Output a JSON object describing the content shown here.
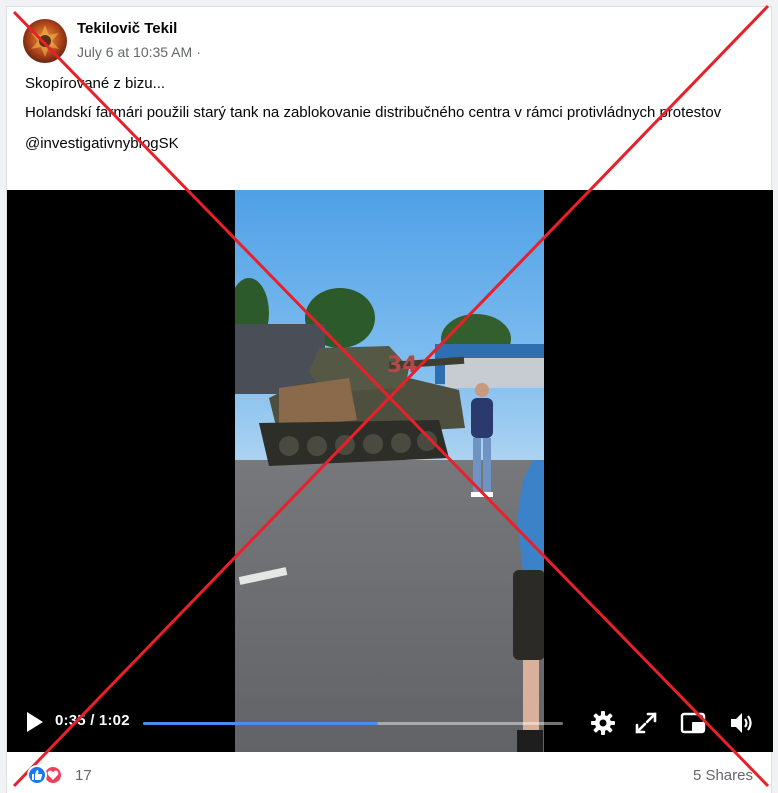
{
  "post": {
    "author": "Tekilovič Tekil",
    "timestamp": "July 6 at 10:35 AM",
    "separator": "·",
    "text_line_1": "Skopírované z bizu...",
    "text_line_2": "Holandskí farmári použili starý tank na zablokovanie distribučného centra v rámci protivládnych protestov",
    "text_line_3": "@investigativnyblogSK"
  },
  "video": {
    "timecode": "0:35 / 1:02",
    "progress": 0.56,
    "tank_marking": "34",
    "icons": [
      "play-icon",
      "settings-gear-icon",
      "fullscreen-icon",
      "picture-in-picture-icon",
      "volume-icon"
    ]
  },
  "footer": {
    "reaction_count": "17",
    "shares": "5 Shares",
    "reaction_icons": [
      "like-icon",
      "love-icon"
    ]
  },
  "overlay": {
    "cross_color": "#e8202a"
  },
  "colors": {
    "accent": "#1877f2",
    "progress": "#4c8af7",
    "secondary_text": "#65676b"
  }
}
